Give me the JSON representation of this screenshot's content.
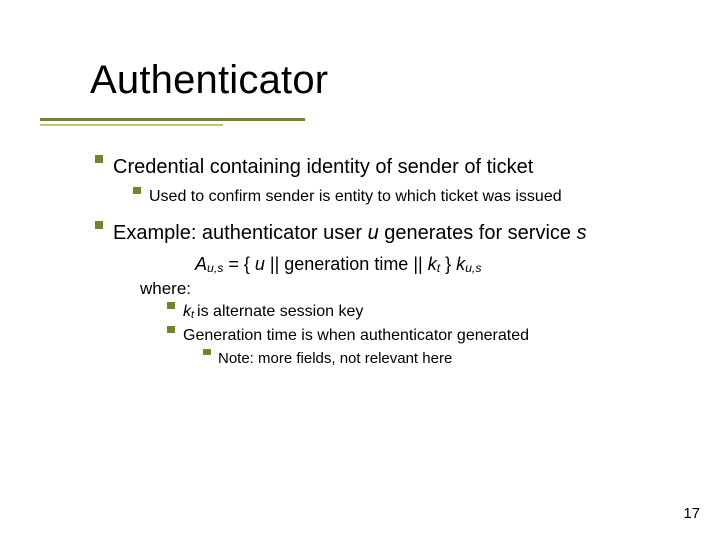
{
  "title": "Authenticator",
  "b1": "Credential containing identity of sender of ticket",
  "b1a": "Used to confirm sender is entity to which ticket was issued",
  "b2_pre": "Example: authenticator user ",
  "b2_u": "u",
  "b2_mid": " generates for service ",
  "b2_s": "s",
  "formula_A": "A",
  "formula_sub1": "u,s",
  "formula_eq": " = { ",
  "formula_u": "u",
  "formula_mid": " || generation time || ",
  "formula_k": "k",
  "formula_ksub": "t",
  "formula_close": " } ",
  "formula_k2": "k",
  "formula_k2sub": "u,s",
  "where": "where:",
  "b2a_k": "k",
  "b2a_sub": "t ",
  "b2a_rest": "is alternate session key",
  "b2b": "Generation time is when authenticator generated",
  "b2b1": "Note: more fields, not relevant here",
  "page": "17"
}
